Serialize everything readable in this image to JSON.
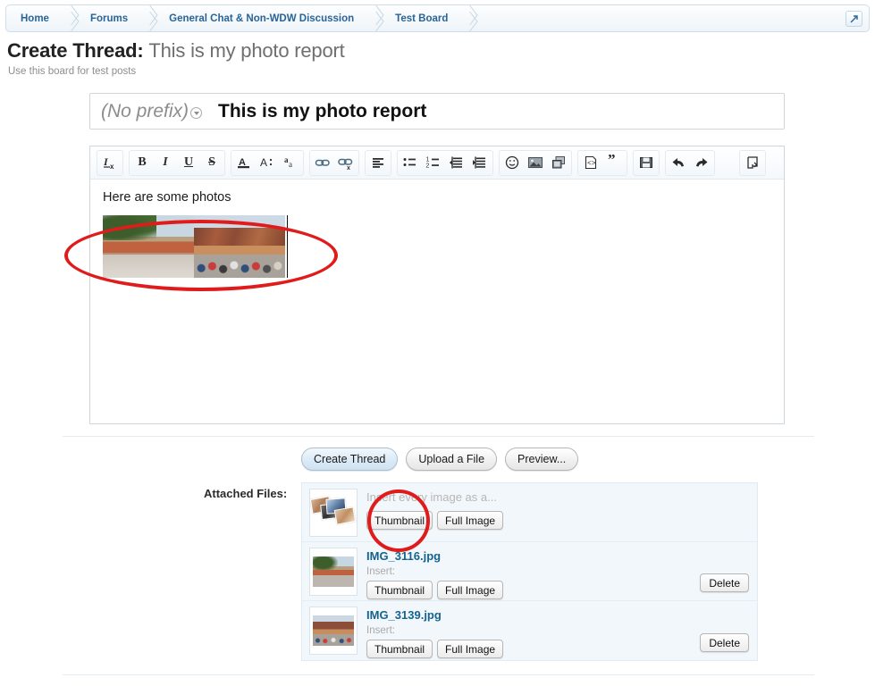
{
  "breadcrumb": {
    "items": [
      {
        "label": "Home"
      },
      {
        "label": "Forums"
      },
      {
        "label": "General Chat & Non-WDW Discussion"
      },
      {
        "label": "Test Board"
      }
    ],
    "popout_icon": "external-link-icon"
  },
  "header": {
    "title_prefix": "Create Thread:",
    "title_value": "This is my photo report",
    "description": "Use this board for test posts"
  },
  "title_row": {
    "prefix_label": "(No prefix)",
    "prefix_caret_icon": "chevron-down-icon",
    "title_text": "This is my photo report"
  },
  "toolbar": {
    "groups": [
      {
        "buttons": [
          {
            "name": "remove-formatting-icon",
            "label": "Tx"
          }
        ]
      },
      {
        "buttons": [
          {
            "name": "bold-icon",
            "label": "B"
          },
          {
            "name": "italic-icon",
            "label": "I"
          },
          {
            "name": "underline-icon",
            "label": "U"
          },
          {
            "name": "strikethrough-icon",
            "label": "S"
          }
        ]
      },
      {
        "buttons": [
          {
            "name": "text-color-icon",
            "label": "A"
          },
          {
            "name": "font-size-icon",
            "label": "A:"
          },
          {
            "name": "font-family-icon",
            "label": "aa"
          }
        ]
      },
      {
        "buttons": [
          {
            "name": "insert-link-icon",
            "label": "link"
          },
          {
            "name": "remove-link-icon",
            "label": "unlink"
          }
        ]
      },
      {
        "buttons": [
          {
            "name": "text-align-icon",
            "label": "align"
          }
        ]
      },
      {
        "buttons": [
          {
            "name": "bulleted-list-icon",
            "label": "ul"
          },
          {
            "name": "numbered-list-icon",
            "label": "ol"
          },
          {
            "name": "outdent-icon",
            "label": "outdent"
          },
          {
            "name": "indent-icon",
            "label": "indent"
          }
        ]
      },
      {
        "buttons": [
          {
            "name": "smilie-icon",
            "label": "smiley"
          },
          {
            "name": "insert-image-icon",
            "label": "image"
          },
          {
            "name": "insert-media-icon",
            "label": "media"
          }
        ]
      },
      {
        "buttons": [
          {
            "name": "insert-code-icon",
            "label": "code"
          },
          {
            "name": "insert-quote-icon",
            "label": "quote"
          }
        ]
      },
      {
        "buttons": [
          {
            "name": "draft-save-icon",
            "label": "save"
          }
        ]
      },
      {
        "buttons": [
          {
            "name": "undo-icon",
            "label": "undo"
          },
          {
            "name": "redo-icon",
            "label": "redo"
          }
        ]
      },
      {
        "buttons": [
          {
            "name": "toggle-bbcode-icon",
            "label": "toggle"
          }
        ]
      }
    ]
  },
  "editor": {
    "line1": "Here are some photos",
    "images": [
      {
        "alt": "theme park walkway with tree"
      },
      {
        "alt": "crowd in front of rock formation"
      }
    ]
  },
  "actions": {
    "create_thread": "Create Thread",
    "upload_a_file": "Upload a File",
    "preview": "Preview..."
  },
  "attachments": {
    "label": "Attached Files:",
    "rows": [
      {
        "icon": "photo-stack-icon",
        "name": "Insert every image as a...",
        "name_is_muted": true,
        "insert_label": "",
        "thumbnail_button": "Thumbnail",
        "full_image_button": "Full Image",
        "delete_button": null
      },
      {
        "icon": "photo-thumbnail",
        "name": "IMG_3116.jpg",
        "name_is_muted": false,
        "insert_label": "Insert:",
        "thumbnail_button": "Thumbnail",
        "full_image_button": "Full Image",
        "delete_button": "Delete"
      },
      {
        "icon": "photo-thumbnail",
        "name": "IMG_3139.jpg",
        "name_is_muted": false,
        "insert_label": "Insert:",
        "thumbnail_button": "Thumbnail",
        "full_image_button": "Full Image",
        "delete_button": "Delete"
      }
    ]
  },
  "annotations": {
    "color": "#e01b1b",
    "ellipse_target": "inserted-images-in-editor",
    "circle_target": "insert-all-thumbnail-button"
  }
}
